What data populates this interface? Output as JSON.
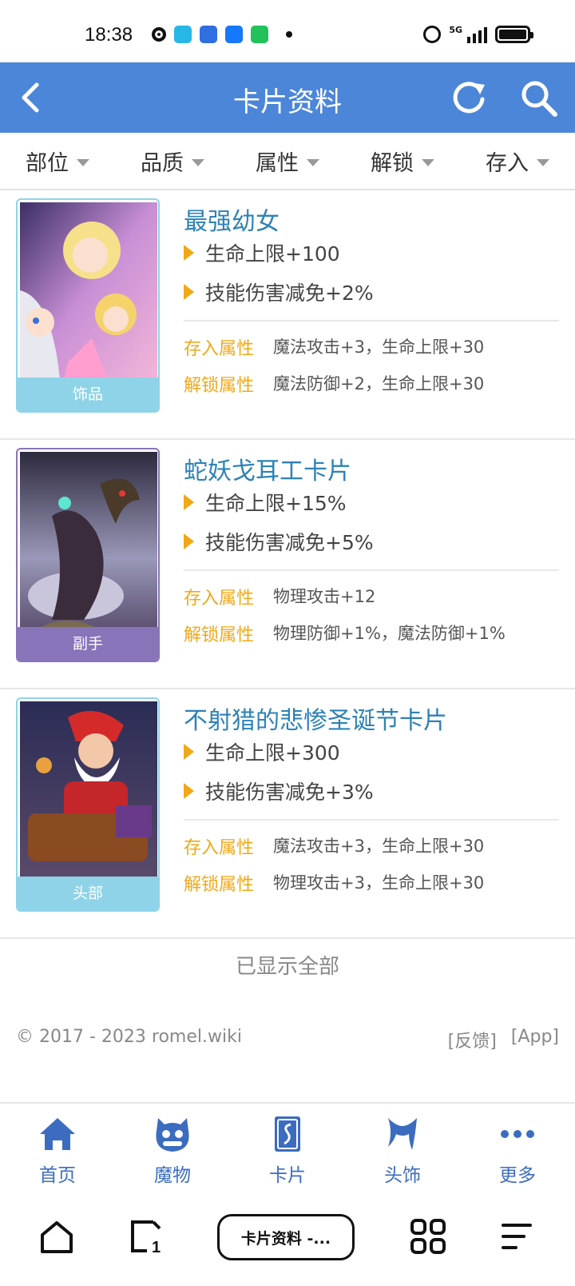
{
  "status_bar": {
    "time": "18:38",
    "network": "5G",
    "app_icon_colors": [
      "#111111",
      "#27b7e6",
      "#2f6fe0",
      "#1677ff",
      "#22c25a"
    ]
  },
  "header": {
    "title": "卡片资料"
  },
  "filters": [
    {
      "label": "部位"
    },
    {
      "label": "品质"
    },
    {
      "label": "属性"
    },
    {
      "label": "解锁"
    },
    {
      "label": "存入"
    }
  ],
  "cards": [
    {
      "name": "最强幼女",
      "slot": "饰品",
      "slot_color": "#8fd3e8",
      "stats": [
        "生命上限+100",
        "技能伤害减免+2%"
      ],
      "deposit_label": "存入属性",
      "deposit_value": "魔法攻击+3，生命上限+30",
      "unlock_label": "解锁属性",
      "unlock_value": "魔法防御+2，生命上限+30"
    },
    {
      "name": "蛇妖戈耳工卡片",
      "slot": "副手",
      "slot_color": "#8874b8",
      "stats": [
        "生命上限+15%",
        "技能伤害减免+5%"
      ],
      "deposit_label": "存入属性",
      "deposit_value": "物理攻击+12",
      "unlock_label": "解锁属性",
      "unlock_value": "物理防御+1%，魔法防御+1%"
    },
    {
      "name": "不射猎的悲惨圣诞节卡片",
      "slot": "头部",
      "slot_color": "#8fd3e8",
      "stats": [
        "生命上限+300",
        "技能伤害减免+3%"
      ],
      "deposit_label": "存入属性",
      "deposit_value": "魔法攻击+3，生命上限+30",
      "unlock_label": "解锁属性",
      "unlock_value": "物理攻击+3，生命上限+30"
    }
  ],
  "list_end_text": "已显示全部",
  "footer": {
    "copyright": "© 2017 - 2023 romel.wiki",
    "feedback": "[反馈]",
    "app": "[App]"
  },
  "bottom_nav": [
    {
      "label": "首页",
      "icon": "home-icon"
    },
    {
      "label": "魔物",
      "icon": "monster-icon"
    },
    {
      "label": "卡片",
      "icon": "card-icon"
    },
    {
      "label": "头饰",
      "icon": "headwear-icon"
    },
    {
      "label": "更多",
      "icon": "more-icon"
    }
  ],
  "system_nav": {
    "current_tab_title": "卡片资料 -..."
  },
  "colors": {
    "header_bg": "#4c86d9",
    "card_title": "#2d82b5",
    "attr_label": "#f0a818",
    "nav_accent": "#3b6cc0"
  }
}
